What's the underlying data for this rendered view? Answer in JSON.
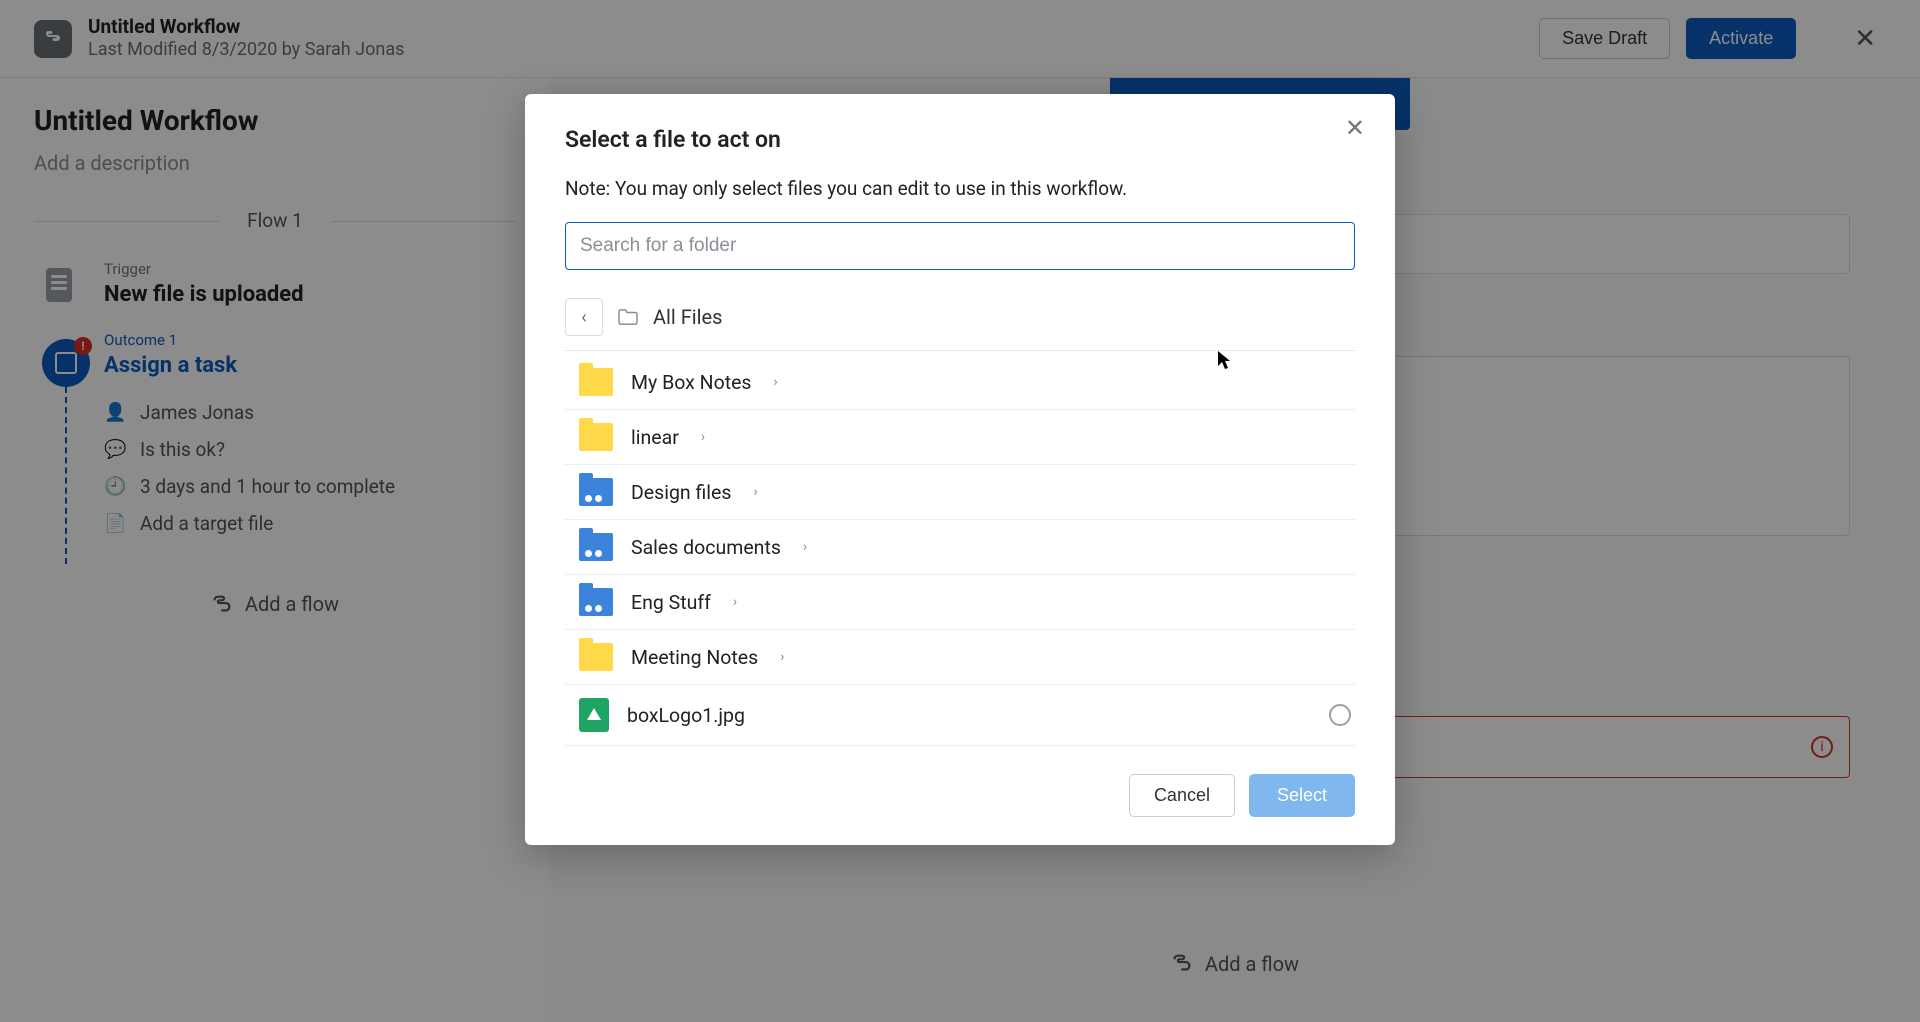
{
  "header": {
    "title": "Untitled Workflow",
    "subtitle": "Last Modified 8/3/2020 by Sarah Jonas",
    "save_draft": "Save Draft",
    "activate": "Activate"
  },
  "workflow": {
    "title": "Untitled Workflow",
    "description_placeholder": "Add a description",
    "flow_label": "Flow 1",
    "trigger": {
      "label": "Trigger",
      "title": "New file is uploaded"
    },
    "outcome": {
      "label": "Outcome 1",
      "title": "Assign a task",
      "assignee": "James Jonas",
      "message": "Is this ok?",
      "due": "3 days and 1 hour to complete",
      "target": "Add a target file"
    },
    "add_flow": "Add a flow"
  },
  "modal": {
    "title": "Select a file to act on",
    "note": "Note: You may only select files you can edit to use in this workflow.",
    "search_placeholder": "Search for a folder",
    "breadcrumb": "All Files",
    "items": [
      {
        "name": "My Box Notes",
        "type": "folder-yellow",
        "has_children": true
      },
      {
        "name": "linear",
        "type": "folder-yellow",
        "has_children": true
      },
      {
        "name": "Design files",
        "type": "folder-blue",
        "has_children": true
      },
      {
        "name": "Sales documents",
        "type": "folder-blue",
        "has_children": true
      },
      {
        "name": "Eng Stuff",
        "type": "folder-blue",
        "has_children": true
      },
      {
        "name": "Meeting Notes",
        "type": "folder-yellow",
        "has_children": true
      },
      {
        "name": "boxLogo1.jpg",
        "type": "file-green",
        "has_children": false
      }
    ],
    "cancel": "Cancel",
    "select": "Select"
  },
  "right_panel": {
    "add_flow": "Add a flow"
  }
}
